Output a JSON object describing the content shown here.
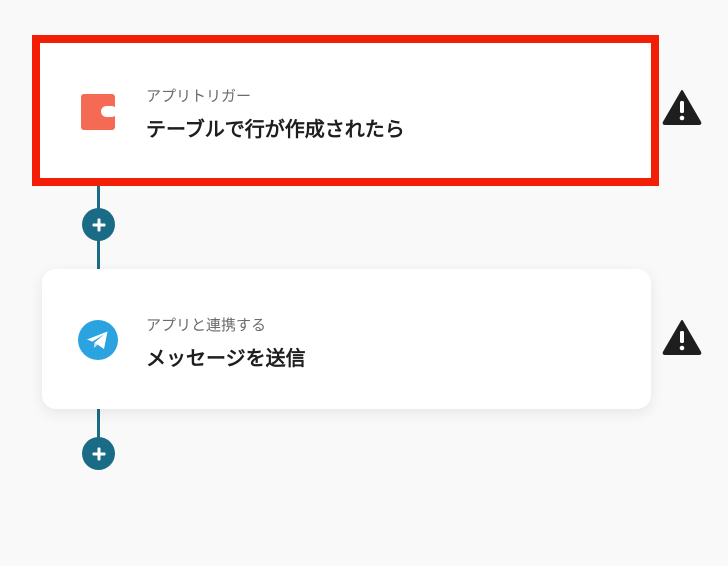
{
  "steps": [
    {
      "subtitle": "アプリトリガー",
      "title": "テーブルで行が作成されたら",
      "icon": "coda-icon",
      "icon_color": "#f46a54",
      "highlighted": true
    },
    {
      "subtitle": "アプリと連携する",
      "title": "メッセージを送信",
      "icon": "telegram-icon",
      "icon_color": "#2aa3e0",
      "highlighted": false
    }
  ],
  "colors": {
    "connector": "#1a6b85",
    "highlight_border": "#f21f06",
    "warning": "#1e1e1e"
  },
  "icons": {
    "add_step": "plus-icon",
    "warning": "warning-icon"
  }
}
